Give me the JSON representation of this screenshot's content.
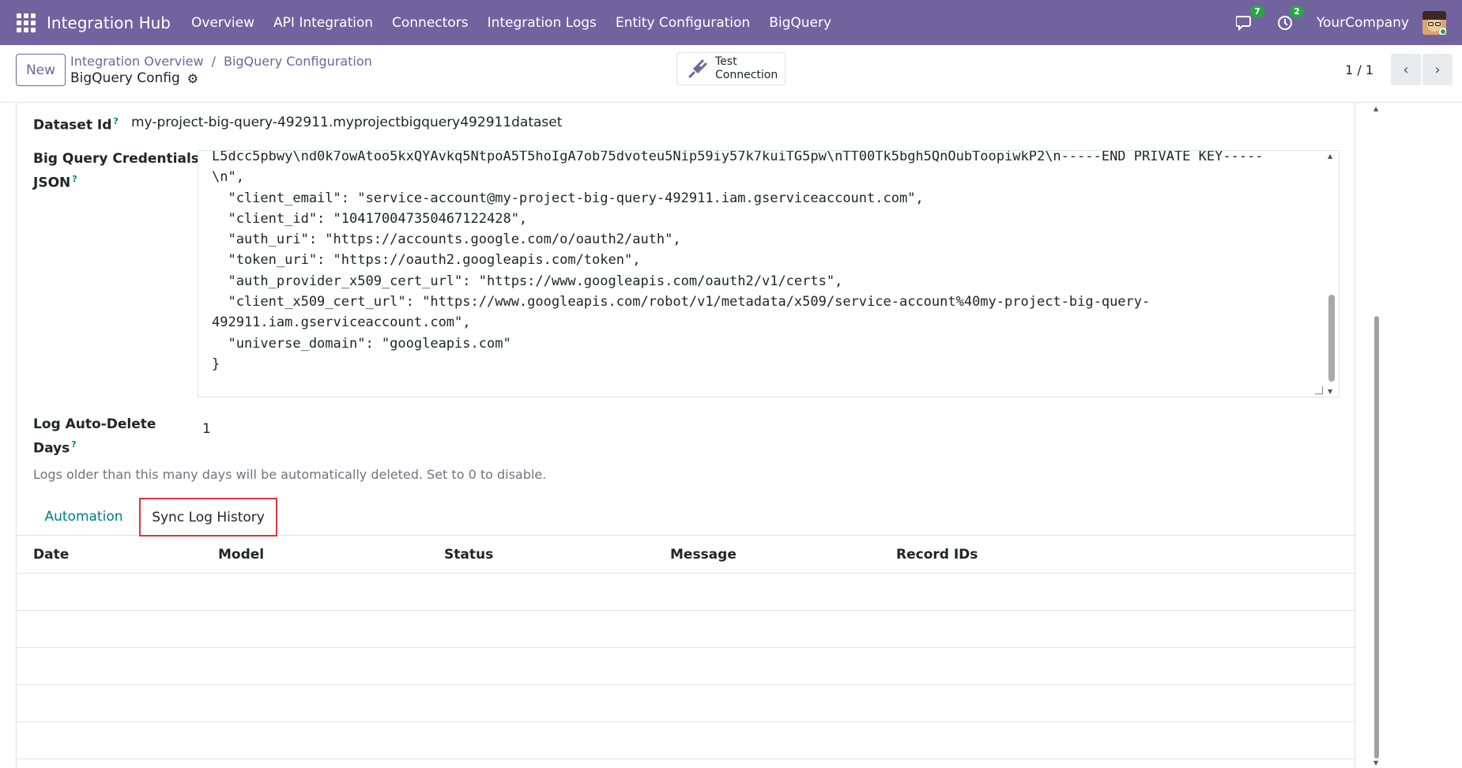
{
  "navbar": {
    "brand": "Integration Hub",
    "menu": [
      "Overview",
      "API Integration",
      "Connectors",
      "Integration Logs",
      "Entity Configuration",
      "BigQuery"
    ],
    "messages_count": "7",
    "activities_count": "2",
    "company": "YourCompany"
  },
  "control": {
    "new_label": "New",
    "breadcrumb": [
      "Integration Overview",
      "BigQuery Configuration"
    ],
    "breadcrumb_sep": "/",
    "record_name": "BigQuery Config",
    "test_label_1": "Test",
    "test_label_2": "Connection",
    "pager": "1 / 1"
  },
  "form": {
    "dataset_label": "Dataset Id",
    "dataset_value": "my-project-big-query-492911.myprojectbigquery492911dataset",
    "credentials_label_1": "Big Query Credentials",
    "credentials_label_2": "JSON",
    "credentials_json": "L5dcc5pbwy\\nd0k7owAtoo5kxQYAvkq5NtpoA5T5hoIgA7ob75dvoteu5Nip59iy57k7kuiTG5pw\\nTT00Tk5bgh5QnOubToopiwkP2\\n-----END PRIVATE KEY-----\n\\n\",\n  \"client_email\": \"service-account@my-project-big-query-492911.iam.gserviceaccount.com\",\n  \"client_id\": \"104170047350467122428\",\n  \"auth_uri\": \"https://accounts.google.com/o/oauth2/auth\",\n  \"token_uri\": \"https://oauth2.googleapis.com/token\",\n  \"auth_provider_x509_cert_url\": \"https://www.googleapis.com/oauth2/v1/certs\",\n  \"client_x509_cert_url\": \"https://www.googleapis.com/robot/v1/metadata/x509/service-account%40my-project-big-query-\n492911.iam.gserviceaccount.com\",\n  \"universe_domain\": \"googleapis.com\"\n}",
    "log_days_label_1": "Log Auto-Delete",
    "log_days_label_2": "Days",
    "log_days_value": "1",
    "help_text": "Logs older than this many days will be automatically deleted. Set to 0 to disable.",
    "help_marker": "?"
  },
  "tabs": [
    "Automation",
    "Sync Log History"
  ],
  "table": {
    "columns": [
      "Date",
      "Model",
      "Status",
      "Message",
      "Record IDs"
    ]
  },
  "colors": {
    "brand": "#71639e",
    "accent": "#017e84",
    "badge": "#28a745",
    "highlight": "#d9363e"
  }
}
